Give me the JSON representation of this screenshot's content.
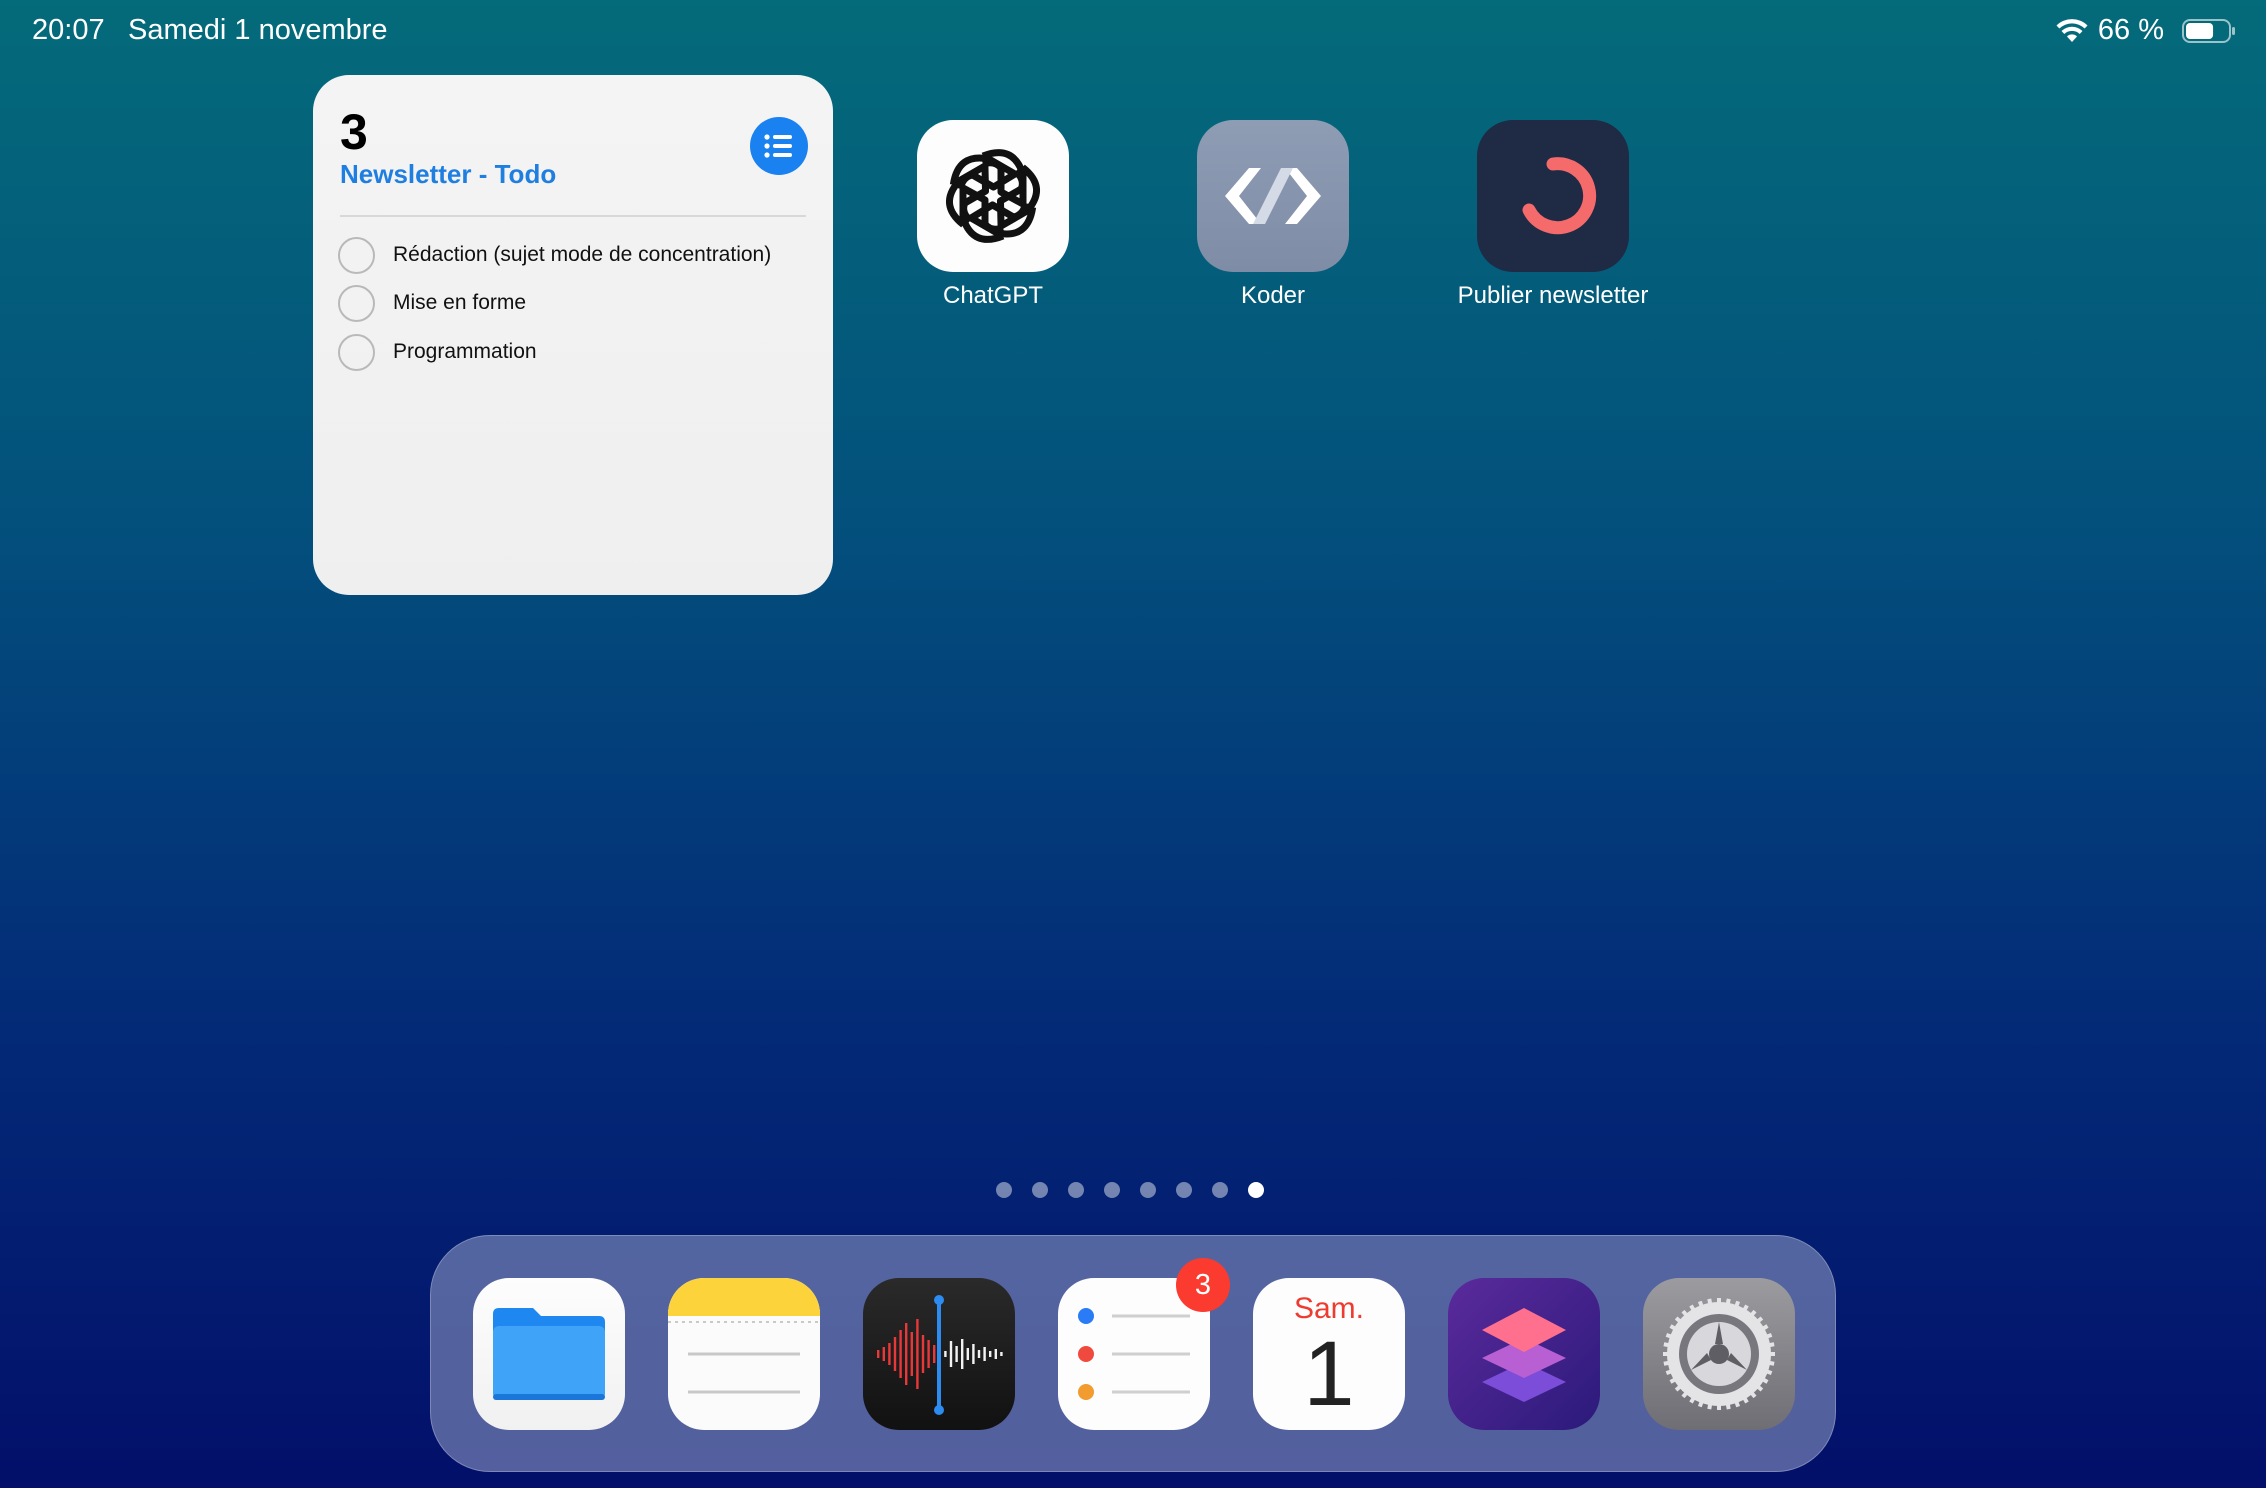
{
  "status_bar": {
    "time": "20:07",
    "date": "Samedi 1 novembre",
    "battery_percent_label": "66 %",
    "battery_level": 0.66
  },
  "widget": {
    "count": "3",
    "list_name": "Newsletter - Todo",
    "accent_color": "#1a82f0",
    "tasks": [
      {
        "label": "Rédaction (sujet mode de concentration)"
      },
      {
        "label": "Mise en forme"
      },
      {
        "label": "Programmation"
      }
    ]
  },
  "apps": [
    {
      "label": "ChatGPT",
      "icon": "chatgpt-icon"
    },
    {
      "label": "Koder",
      "icon": "koder-icon"
    },
    {
      "label": "Publier newsletter",
      "icon": "publier-newsletter-icon"
    }
  ],
  "page_indicator": {
    "total": 8,
    "current": 8
  },
  "dock": {
    "apps": [
      {
        "name": "Files",
        "icon": "files-icon"
      },
      {
        "name": "Notes",
        "icon": "notes-icon"
      },
      {
        "name": "Voice Memos",
        "icon": "voice-memos-icon"
      },
      {
        "name": "Reminders",
        "icon": "reminders-icon",
        "badge": "3"
      },
      {
        "name": "Calendar",
        "icon": "calendar-icon",
        "day": "Sam.",
        "date": "1"
      },
      {
        "name": "Shortcuts",
        "icon": "shortcuts-icon"
      },
      {
        "name": "Settings",
        "icon": "settings-icon"
      }
    ]
  }
}
